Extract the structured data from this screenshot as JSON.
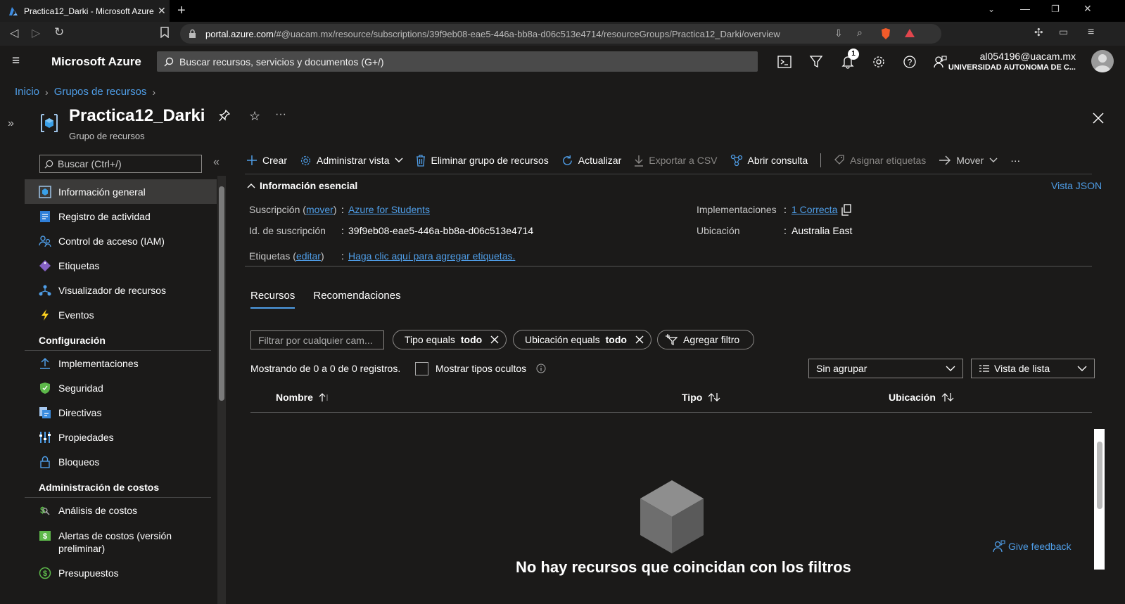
{
  "browser": {
    "tab_title": "Practica12_Darki - Microsoft Azure",
    "url_host": "portal.azure.com",
    "url_path": "/#@uacam.mx/resource/subscriptions/39f9eb08-eae5-446a-bb8a-d06c513e4714/resourceGroups/Practica12_Darki/overview",
    "notifications_count": "1"
  },
  "header": {
    "brand": "Microsoft Azure",
    "search_placeholder": "Buscar recursos, servicios y documentos (G+/)",
    "user_email": "al054196@uacam.mx",
    "user_org": "UNIVERSIDAD AUTONOMA DE C..."
  },
  "breadcrumb": [
    "Inicio",
    "Grupos de recursos"
  ],
  "page": {
    "title": "Practica12_Darki",
    "subtitle": "Grupo de recursos"
  },
  "nav": {
    "search_placeholder": "Buscar (Ctrl+/)",
    "items": [
      {
        "label": "Información general"
      },
      {
        "label": "Registro de actividad"
      },
      {
        "label": "Control de acceso (IAM)"
      },
      {
        "label": "Etiquetas"
      },
      {
        "label": "Visualizador de recursos"
      },
      {
        "label": "Eventos"
      }
    ],
    "section_config": "Configuración",
    "config_items": [
      {
        "label": "Implementaciones"
      },
      {
        "label": "Seguridad"
      },
      {
        "label": "Directivas"
      },
      {
        "label": "Propiedades"
      },
      {
        "label": "Bloqueos"
      }
    ],
    "section_costs": "Administración de costos",
    "cost_items": [
      {
        "label": "Análisis de costos"
      },
      {
        "label": "Alertas de costos (versión preliminar)"
      },
      {
        "label": "Presupuestos"
      }
    ]
  },
  "commands": {
    "create": "Crear",
    "manage_view": "Administrar vista",
    "delete_rg": "Eliminar grupo de recursos",
    "refresh": "Actualizar",
    "export_csv": "Exportar a CSV",
    "open_query": "Abrir consulta",
    "assign_tags": "Asignar etiquetas",
    "move": "Mover",
    "more": "···"
  },
  "essentials": {
    "header": "Información esencial",
    "json_view": "Vista JSON",
    "subscription_label": "Suscripción",
    "subscription_move": "mover",
    "subscription_value": "Azure for Students",
    "subscription_id_label": "Id. de suscripción",
    "subscription_id_value": "39f9eb08-eae5-446a-bb8a-d06c513e4714",
    "tags_label": "Etiquetas",
    "tags_edit": "editar",
    "tags_value": "Haga clic aquí para agregar etiquetas.",
    "deployments_label": "Implementaciones",
    "deployments_value": "1 Correcta",
    "location_label": "Ubicación",
    "location_value": "Australia East"
  },
  "tabs": [
    "Recursos",
    "Recomendaciones"
  ],
  "filters": {
    "input_placeholder": "Filtrar por cualquier cam...",
    "type_prefix": "Tipo equals",
    "type_value": "todo",
    "location_prefix": "Ubicación equals",
    "location_value": "todo",
    "add_filter": "Agregar filtro"
  },
  "records_text": "Mostrando de 0 a 0 de 0 registros.",
  "show_hidden": "Mostrar tipos ocultos",
  "grouping": "Sin agrupar",
  "view_mode": "Vista de lista",
  "table": {
    "columns": [
      "Nombre",
      "Tipo",
      "Ubicación"
    ]
  },
  "empty_message": "No hay recursos que coincidan con los filtros",
  "feedback": "Give feedback",
  "colors": {
    "accent": "#4f9ee8",
    "background": "#1b1a19"
  }
}
